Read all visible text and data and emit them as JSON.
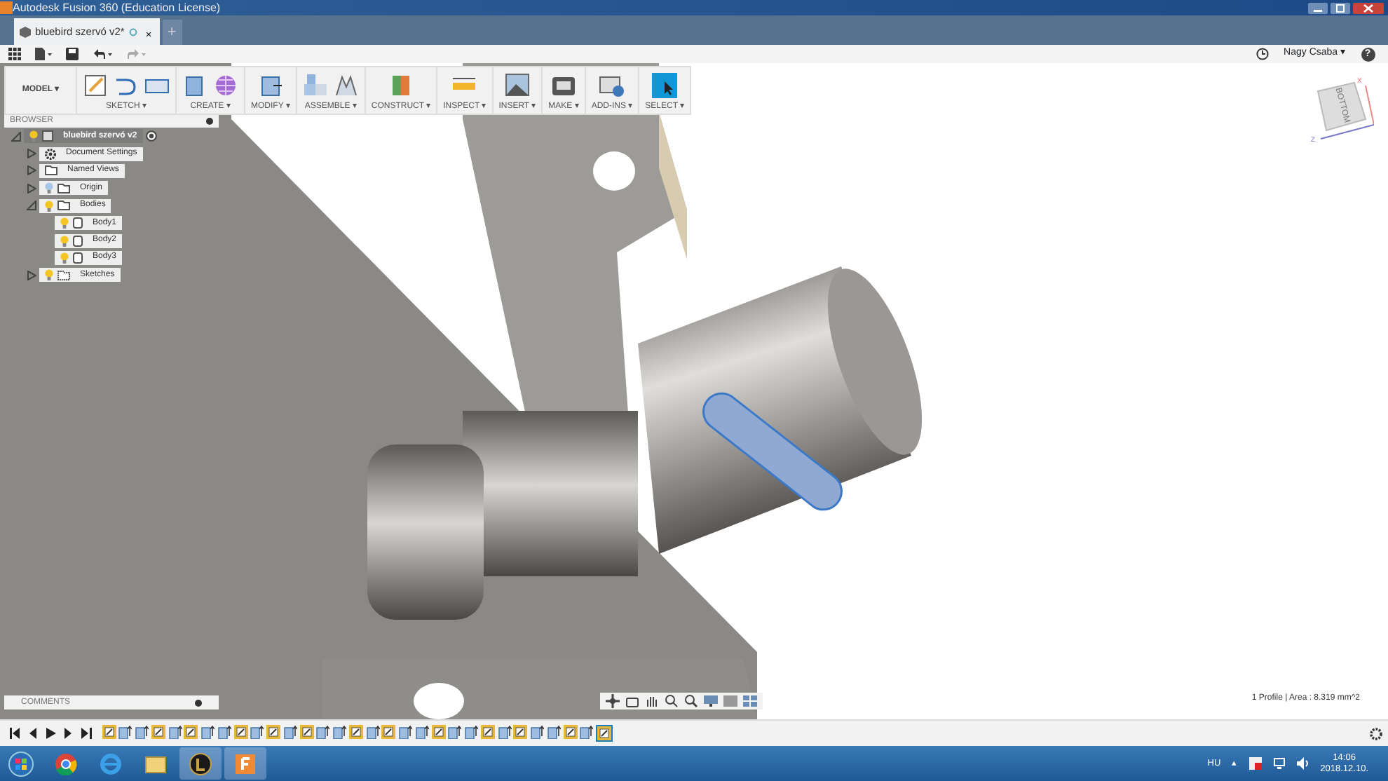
{
  "window": {
    "title": "Autodesk Fusion 360 (Education License)"
  },
  "document_tab": {
    "title": "bluebird szervó v2*",
    "close": "×",
    "new_tab": "+"
  },
  "user": {
    "name": "Nagy Csaba ▾",
    "help": "?"
  },
  "ribbon": {
    "workspace": "MODEL ▾",
    "groups": [
      {
        "label": "SKETCH ▾",
        "tools": [
          {
            "kind": "sketch"
          },
          {
            "kind": "arc"
          },
          {
            "kind": "rectangle"
          }
        ]
      },
      {
        "label": "CREATE ▾",
        "tools": [
          {
            "kind": "box"
          },
          {
            "kind": "lattice"
          }
        ]
      },
      {
        "label": "MODIFY ▾",
        "tools": [
          {
            "kind": "pushpull"
          }
        ]
      },
      {
        "label": "ASSEMBLE ▾",
        "tools": [
          {
            "kind": "component"
          },
          {
            "kind": "joint"
          }
        ]
      },
      {
        "label": "CONSTRUCT ▾",
        "tools": [
          {
            "kind": "plane"
          }
        ]
      },
      {
        "label": "INSPECT ▾",
        "tools": [
          {
            "kind": "measure"
          }
        ]
      },
      {
        "label": "INSERT ▾",
        "tools": [
          {
            "kind": "image"
          }
        ]
      },
      {
        "label": "MAKE ▾",
        "tools": [
          {
            "kind": "printer"
          }
        ]
      },
      {
        "label": "ADD-INS ▾",
        "tools": [
          {
            "kind": "window"
          }
        ]
      },
      {
        "label": "SELECT ▾",
        "tools": [
          {
            "kind": "select"
          }
        ]
      }
    ]
  },
  "browser": {
    "title": "BROWSER",
    "items": [
      {
        "label": "bluebird szervó v2",
        "kind": "component",
        "visible": true,
        "expanded": true,
        "selected": true,
        "children": [
          {
            "label": "Document Settings",
            "kind": "settings",
            "expanded": false,
            "selected": false
          },
          {
            "label": "Named Views",
            "kind": "views",
            "expanded": false,
            "selected": false
          },
          {
            "label": "Origin",
            "kind": "folder",
            "visible": false,
            "expanded": false,
            "selected": false
          },
          {
            "label": "Bodies",
            "kind": "folder",
            "visible": true,
            "expanded": true,
            "selected": false,
            "children": [
              {
                "label": "Body1",
                "kind": "body",
                "visible": true,
                "selected": false
              },
              {
                "label": "Body2",
                "kind": "body",
                "visible": true,
                "selected": false
              },
              {
                "label": "Body3",
                "kind": "body",
                "visible": true,
                "selected": false
              }
            ]
          },
          {
            "label": "Sketches",
            "kind": "sketchfolder",
            "visible": true,
            "expanded": false,
            "selected": false
          }
        ]
      }
    ]
  },
  "view_cube": {
    "face": "BOTTOM",
    "axis_x": "X",
    "axis_z": "Z"
  },
  "comments": {
    "title": "COMMENTS"
  },
  "status": "1 Profile | Area : 8.319 mm^2",
  "timeline": [
    {
      "kind": "sketch",
      "selected": false
    },
    {
      "kind": "extrude",
      "selected": false
    },
    {
      "kind": "extrude",
      "selected": false
    },
    {
      "kind": "sketch",
      "selected": false
    },
    {
      "kind": "extrude",
      "selected": false
    },
    {
      "kind": "sketch",
      "selected": false
    },
    {
      "kind": "extrude",
      "selected": false
    },
    {
      "kind": "extrude",
      "selected": false
    },
    {
      "kind": "sketch",
      "selected": false
    },
    {
      "kind": "extrude",
      "selected": false
    },
    {
      "kind": "sketch",
      "selected": false
    },
    {
      "kind": "extrude",
      "selected": false
    },
    {
      "kind": "sketch",
      "selected": false
    },
    {
      "kind": "extrude",
      "selected": false
    },
    {
      "kind": "extrude",
      "selected": false
    },
    {
      "kind": "sketch",
      "selected": false
    },
    {
      "kind": "extrude",
      "selected": false
    },
    {
      "kind": "sketch",
      "selected": false
    },
    {
      "kind": "extrude",
      "selected": false
    },
    {
      "kind": "extrude",
      "selected": false
    },
    {
      "kind": "sketch",
      "selected": false
    },
    {
      "kind": "extrude",
      "selected": false
    },
    {
      "kind": "extrude",
      "selected": false
    },
    {
      "kind": "sketch",
      "selected": false
    },
    {
      "kind": "extrude",
      "selected": false
    },
    {
      "kind": "sketch",
      "selected": false
    },
    {
      "kind": "extrude",
      "selected": false
    },
    {
      "kind": "extrude",
      "selected": false
    },
    {
      "kind": "sketch",
      "selected": false
    },
    {
      "kind": "extrude",
      "selected": false
    },
    {
      "kind": "sketch",
      "selected": true
    }
  ],
  "taskbar": {
    "apps": [
      {
        "kind": "chrome",
        "active": false
      },
      {
        "kind": "ie",
        "active": false
      },
      {
        "kind": "explorer",
        "active": false
      },
      {
        "kind": "game",
        "active": true
      },
      {
        "kind": "fusion",
        "active": true
      }
    ],
    "language": "HU",
    "tray_arrow": "▴",
    "time": "14:06",
    "date": "2018.12.10."
  }
}
